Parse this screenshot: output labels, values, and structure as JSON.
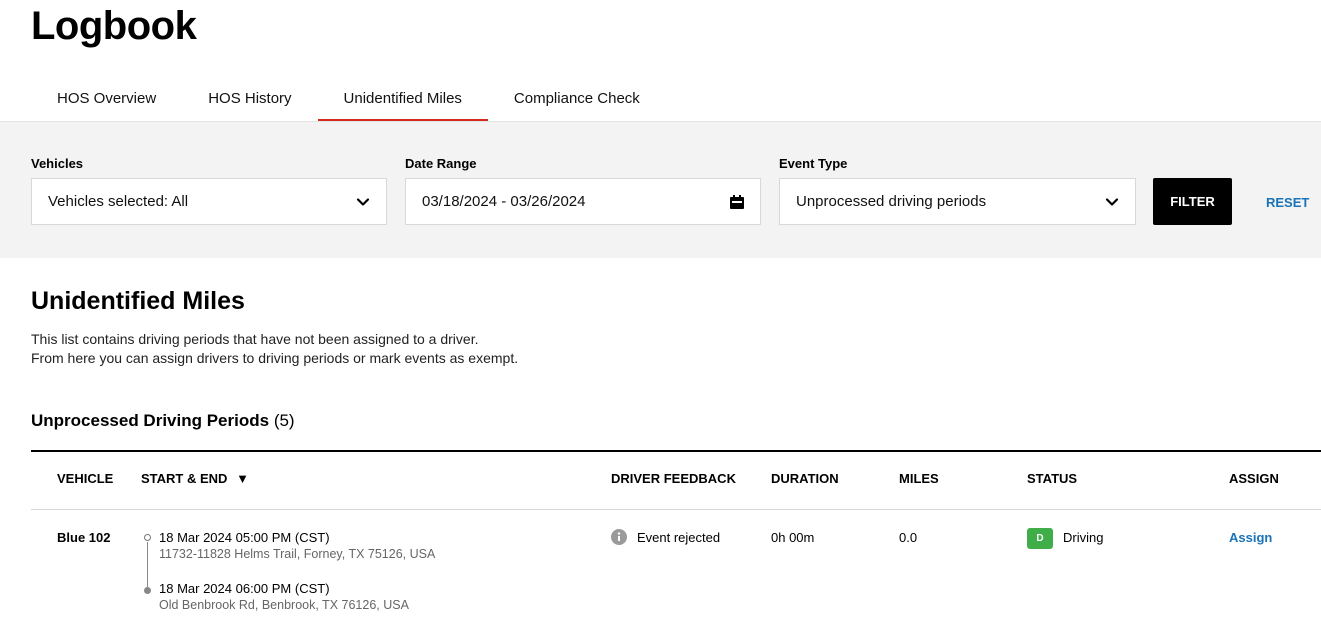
{
  "header": {
    "title": "Logbook"
  },
  "tabs": [
    {
      "label": "HOS Overview"
    },
    {
      "label": "HOS History"
    },
    {
      "label": "Unidentified Miles"
    },
    {
      "label": "Compliance Check"
    }
  ],
  "filters": {
    "vehicles": {
      "label": "Vehicles",
      "value": "Vehicles selected: All"
    },
    "date_range": {
      "label": "Date Range",
      "value": "03/18/2024 - 03/26/2024"
    },
    "event_type": {
      "label": "Event Type",
      "value": "Unprocessed driving periods"
    },
    "filter_label": "FILTER",
    "reset_label": "RESET"
  },
  "section": {
    "title": "Unidentified Miles",
    "description_line1": "This list contains driving periods that have not been assigned to a driver.",
    "description_line2": "From here you can assign drivers to driving periods or mark events as exempt.",
    "subtitle": "Unprocessed Driving Periods",
    "count": "(5)"
  },
  "table": {
    "columns": {
      "vehicle": "VEHICLE",
      "start_end": "START & END",
      "driver_feedback": "DRIVER FEEDBACK",
      "duration": "DURATION",
      "miles": "MILES",
      "status": "STATUS",
      "assign": "ASSIGN"
    },
    "sort_indicator": "▼",
    "rows": [
      {
        "vehicle": "Blue 102",
        "start_time": "18 Mar 2024 05:00 PM (CST)",
        "start_location": "11732-11828 Helms Trail, Forney, TX 75126, USA",
        "end_time": "18 Mar 2024 06:00 PM (CST)",
        "end_location": "Old Benbrook Rd, Benbrook, TX 76126, USA",
        "driver_feedback": "Event rejected",
        "duration": "0h 00m",
        "miles": "0.0",
        "status_badge": "D",
        "status": "Driving",
        "assign": "Assign"
      }
    ]
  },
  "colors": {
    "accent_tab": "#d52b1e",
    "link": "#1a73b8",
    "status_driving": "#3fae49"
  },
  "icons": {
    "vehicles_dropdown": "chevron-down-icon",
    "date_range": "calendar-icon",
    "event_type_dropdown": "chevron-down-icon",
    "feedback": "info-icon"
  }
}
